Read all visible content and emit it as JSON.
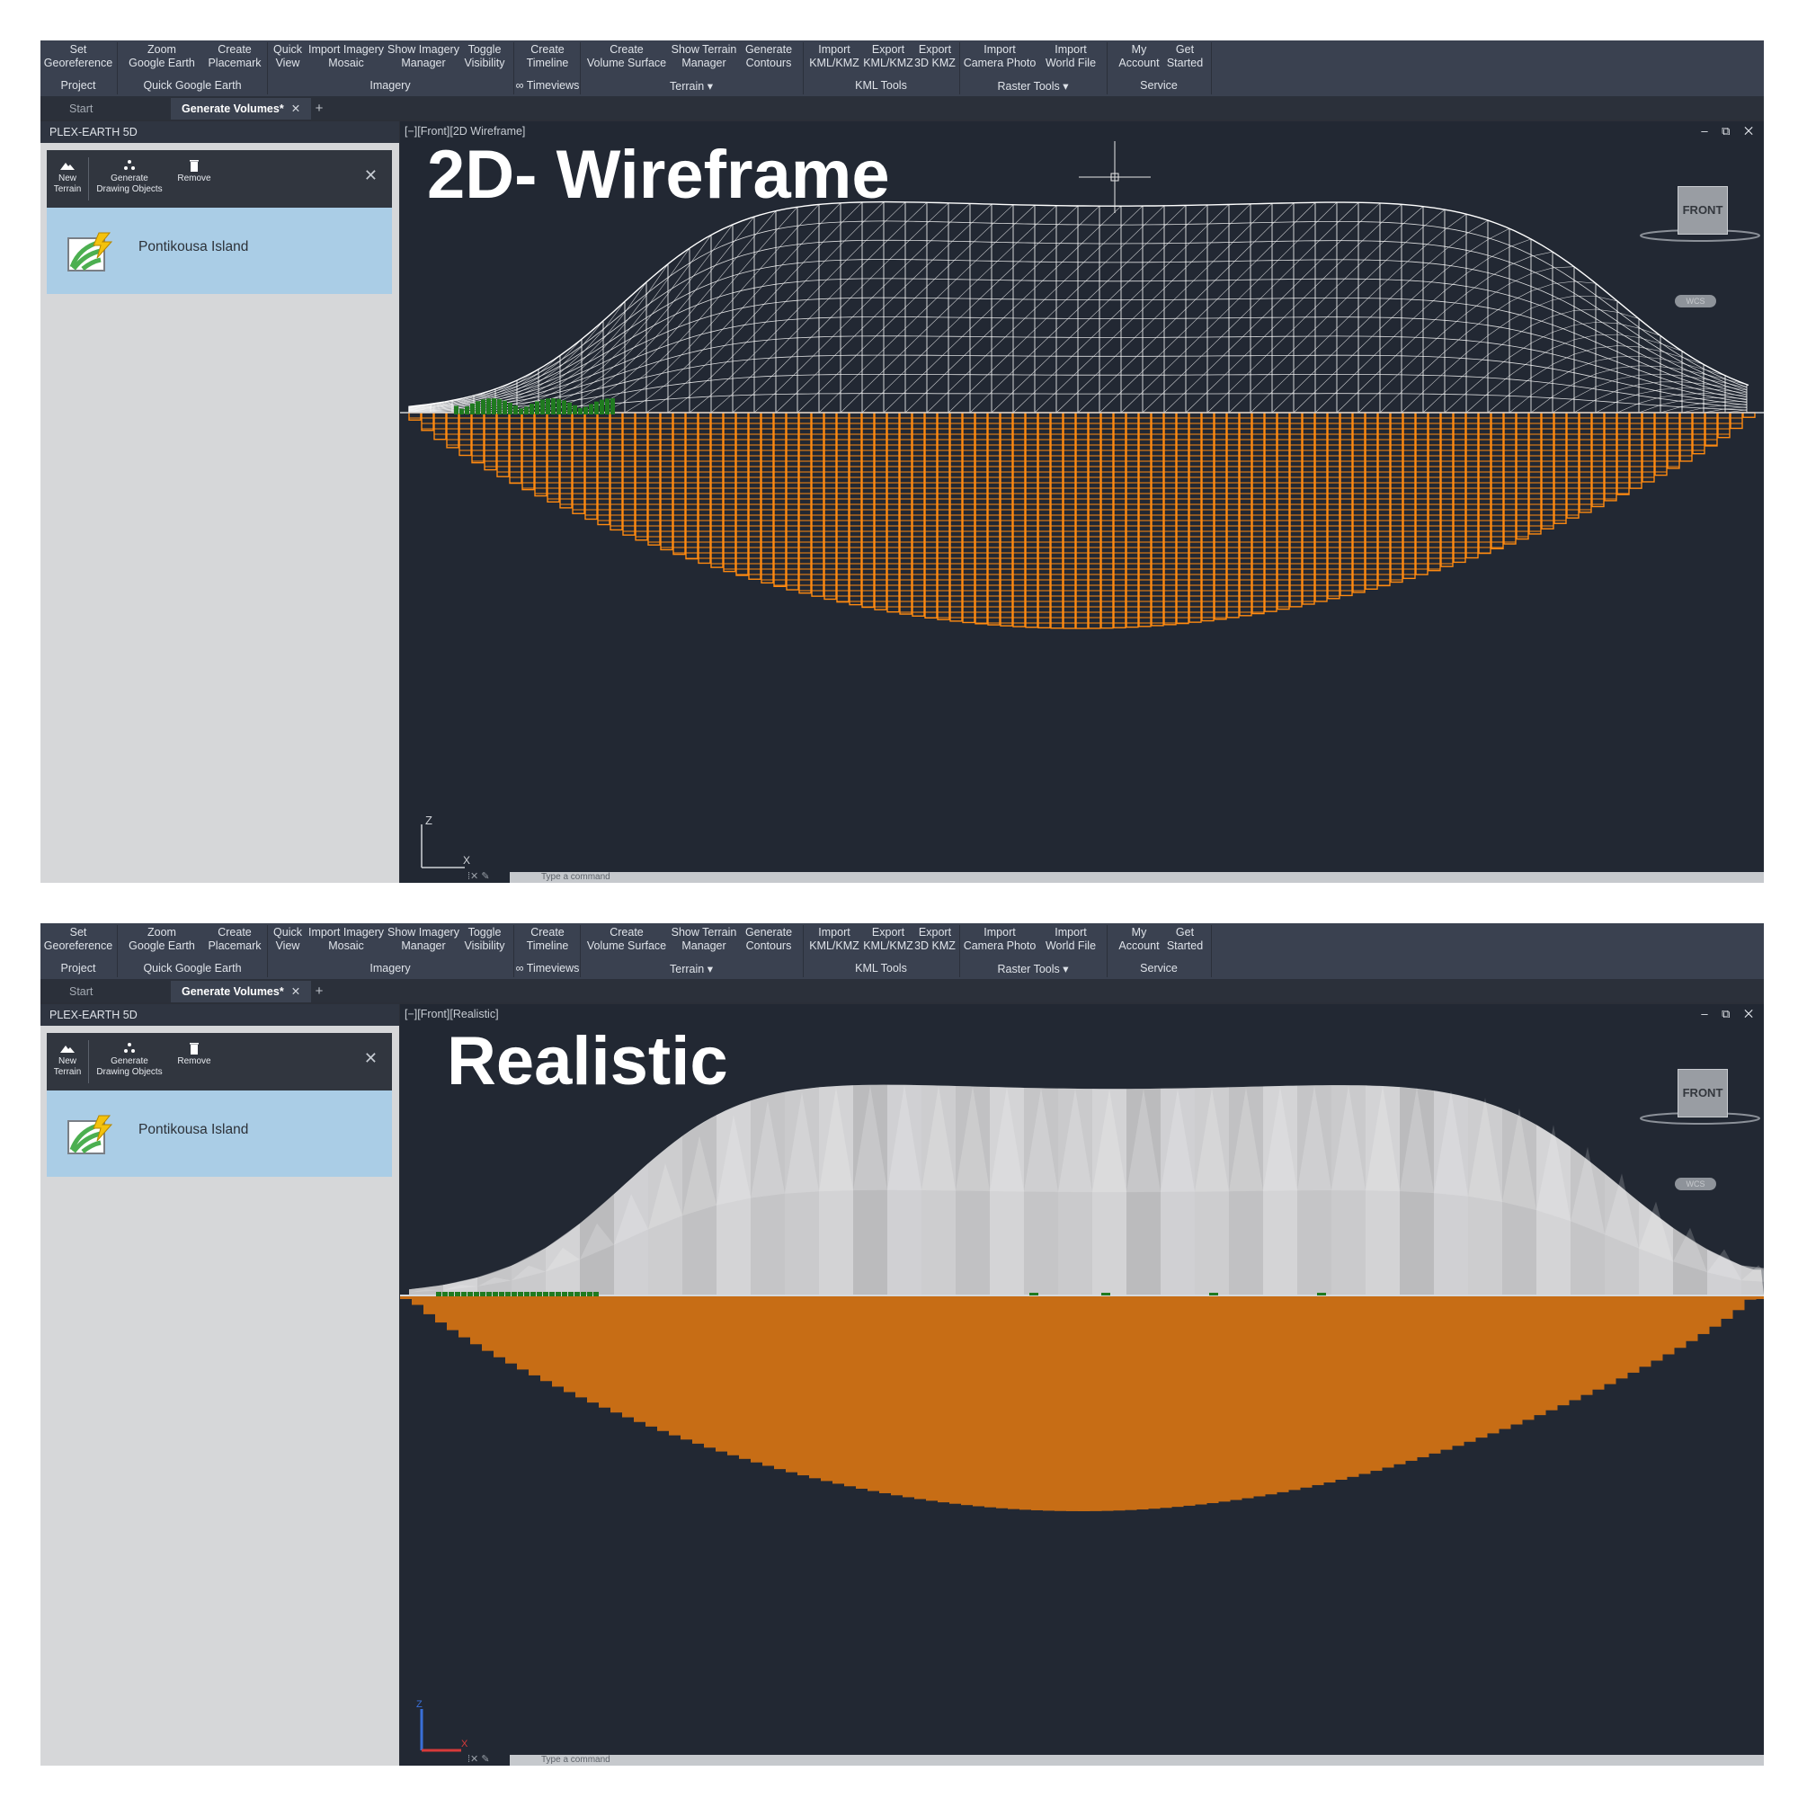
{
  "ribbon": {
    "buttons": [
      {
        "label": "Set\nGeoreference"
      },
      {
        "label": "Zoom\nGoogle Earth"
      },
      {
        "label": "Create\nPlacemark"
      },
      {
        "label": "Quick\nView"
      },
      {
        "label": "Import Imagery\nMosaic"
      },
      {
        "label": "Show Imagery\nManager"
      },
      {
        "label": "Toggle\nVisibility"
      },
      {
        "label": "Create\nTimeline"
      },
      {
        "label": "Create\nVolume Surface"
      },
      {
        "label": "Show Terrain\nManager"
      },
      {
        "label": "Generate\nContours"
      },
      {
        "label": "Import\nKML/KMZ"
      },
      {
        "label": "Export\nKML/KMZ"
      },
      {
        "label": "Export\n3D KMZ"
      },
      {
        "label": "Import\nCamera Photo"
      },
      {
        "label": "Import\nWorld File"
      },
      {
        "label": "My\nAccount"
      },
      {
        "label": "Get\nStarted"
      }
    ],
    "groups": [
      "Project",
      "Quick Google Earth",
      "Imagery",
      "∞ Timeviews",
      "Terrain ▾",
      "KML Tools",
      "Raster Tools ▾",
      "Service"
    ]
  },
  "tabs": {
    "start": "Start",
    "active": "Generate Volumes*",
    "close": "✕",
    "add": "+"
  },
  "sidebar": {
    "title": "PLEX-EARTH 5D",
    "toolbar": {
      "new_terrain": "New\nTerrain",
      "generate": "Generate\nDrawing Objects",
      "remove": "Remove",
      "close": "✕"
    },
    "project_name": "Pontikousa Island"
  },
  "views": {
    "top": {
      "label": "[−][Front][2D Wireframe]",
      "overlay_title": "2D- Wireframe",
      "style": "wireframe"
    },
    "bottom": {
      "label": "[−][Front][Realistic]",
      "overlay_title": "Realistic",
      "style": "realistic"
    }
  },
  "viewcube": {
    "face": "FRONT",
    "wcs": "WCS"
  },
  "window_controls": "– ⧉ ✕",
  "command_line": {
    "placeholder": "Type a command"
  },
  "colors": {
    "fill": "#ff8a10",
    "fill_solid": "#c76d15",
    "surface": "#ffffff",
    "vegetation": "#1f7a1f",
    "background": "#222833"
  }
}
